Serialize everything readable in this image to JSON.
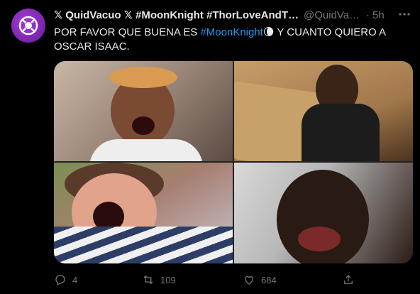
{
  "tweet": {
    "display_name": "𝕏 QuidVacuo 𝕏 #MoonKnight #ThorLoveAndTh...",
    "handle": "@QuidVac...",
    "separator": "·",
    "time": "5h",
    "text_parts": {
      "before": "POR FAVOR QUE BUENA ES ",
      "hashtag": "#MoonKnight",
      "emoji": "🌘",
      "after": " Y CUANTO QUIERO A OSCAR ISAAC."
    }
  },
  "media": {
    "images": [
      {
        "name": "screaming-woman-headband"
      },
      {
        "name": "man-in-box"
      },
      {
        "name": "screaming-little-girl"
      },
      {
        "name": "crying-man"
      }
    ]
  },
  "actions": {
    "reply_count": "4",
    "retweet_count": "109",
    "like_count": "684"
  },
  "colors": {
    "background": "#000000",
    "text": "#e7e9ea",
    "muted": "#71767b",
    "hashtag": "#1d9bf0",
    "avatar": "#8a2bbf"
  },
  "icons": {
    "avatar": "purple-circle-logo-icon",
    "more": "more-dots-icon",
    "reply": "reply-icon",
    "retweet": "retweet-icon",
    "like": "heart-icon",
    "share": "share-icon"
  }
}
